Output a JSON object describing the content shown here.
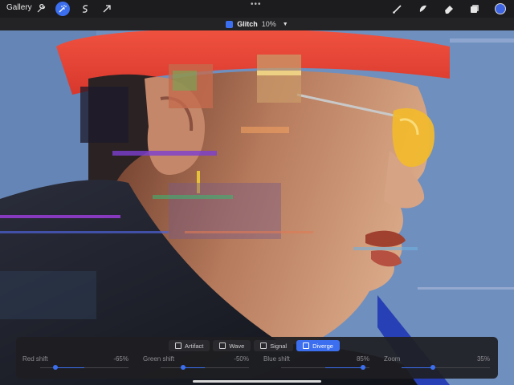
{
  "toolbar": {
    "gallery_label": "Gallery",
    "left_tools": [
      "wrench-icon",
      "magic-wand-icon",
      "selection-s-icon",
      "arrow-transform-icon"
    ],
    "active_tool": "magic-wand-icon",
    "right_tools": [
      "brush-icon",
      "smudge-icon",
      "eraser-icon",
      "layers-icon",
      "color-swatch"
    ],
    "active_color": "#3f64e2",
    "more_dots": "•••"
  },
  "adjustment": {
    "name": "Glitch",
    "percent": "10%"
  },
  "panel": {
    "modes": [
      {
        "label": "Artifact",
        "active": false
      },
      {
        "label": "Wave",
        "active": false
      },
      {
        "label": "Signal",
        "active": false
      },
      {
        "label": "Diverge",
        "active": true
      }
    ],
    "sliders": [
      {
        "label": "Red shift",
        "value_text": "-65%",
        "value": -0.65,
        "bipolar": true
      },
      {
        "label": "Green shift",
        "value_text": "-50%",
        "value": -0.5,
        "bipolar": true
      },
      {
        "label": "Blue shift",
        "value_text": "85%",
        "value": 0.85,
        "bipolar": true
      },
      {
        "label": "Zoom",
        "value_text": "35%",
        "value": 0.35,
        "bipolar": false
      }
    ]
  },
  "colors": {
    "accent": "#3b6ff0",
    "hat": "#e8453a",
    "background": "#6d8dbb",
    "sunglasses": "#f1b92e"
  }
}
